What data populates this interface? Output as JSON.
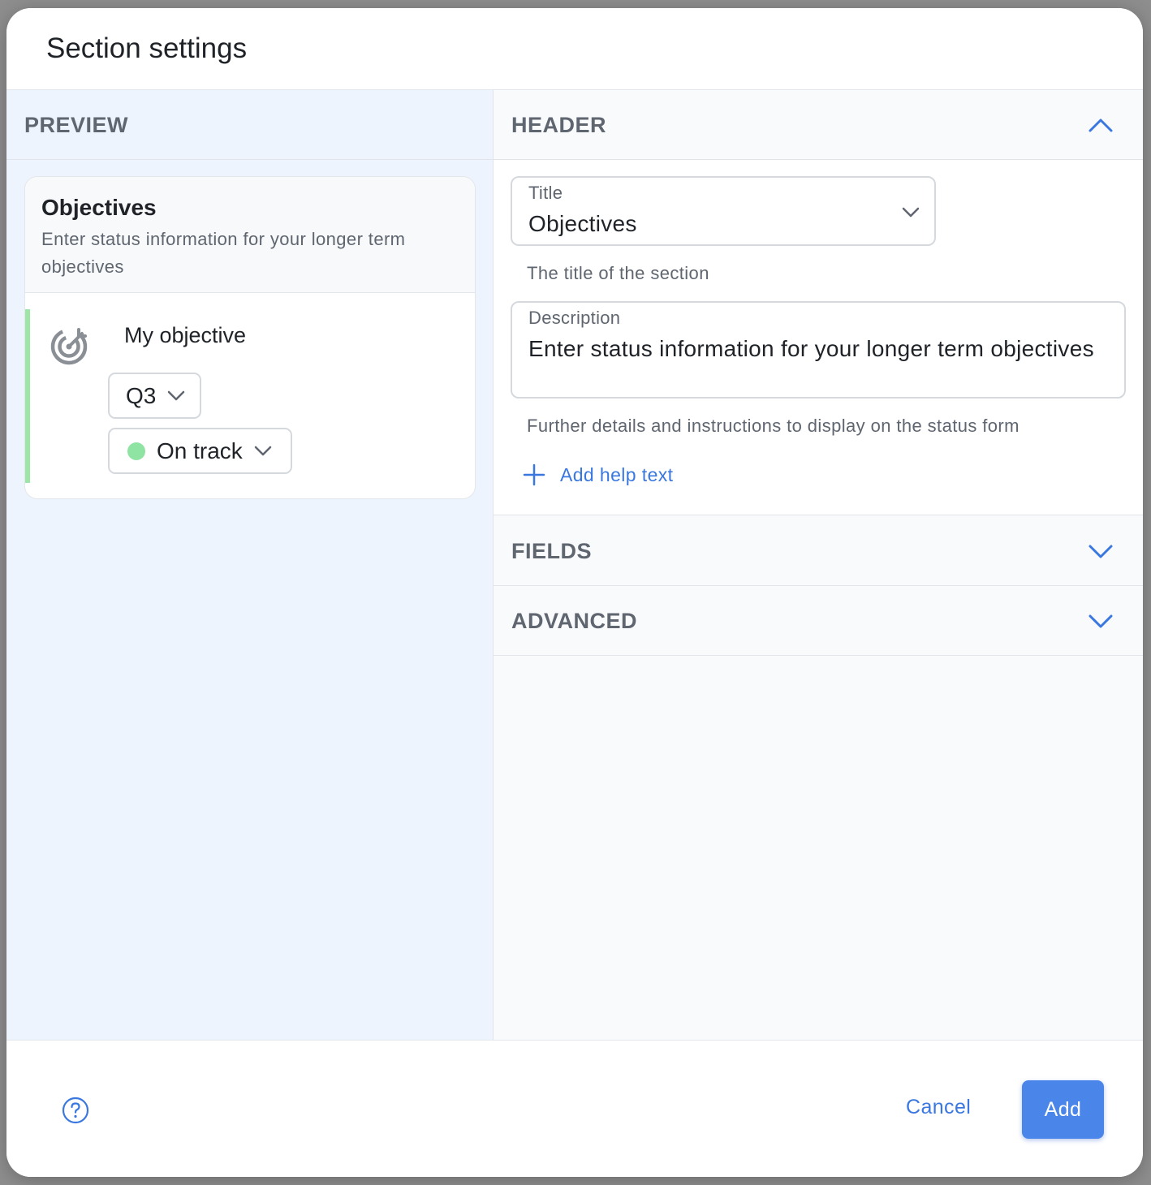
{
  "modal": {
    "title": "Section settings"
  },
  "preview": {
    "heading": "PREVIEW",
    "card": {
      "title": "Objectives",
      "description": "Enter status information for your longer term objectives",
      "objective_name": "My objective",
      "period": "Q3",
      "status": "On track",
      "status_color": "#8fe3a3",
      "accent_color": "#9ee6a8",
      "icon": "target-icon"
    }
  },
  "settings": {
    "header_section": {
      "label": "HEADER",
      "expanded": true,
      "title_field": {
        "label": "Title",
        "value": "Objectives",
        "hint": "The title of the section"
      },
      "description_field": {
        "label": "Description",
        "value": "Enter status information for your longer term objectives",
        "hint": "Further details and instructions to display on the status form"
      },
      "add_help_text": "Add help text"
    },
    "fields_section": {
      "label": "FIELDS",
      "expanded": false
    },
    "advanced_section": {
      "label": "ADVANCED",
      "expanded": false
    }
  },
  "footer": {
    "help_icon": "question-circle-icon",
    "cancel_label": "Cancel",
    "add_label": "Add"
  },
  "colors": {
    "accent": "#4a86ea",
    "link": "#3a78e0",
    "preview_bg": "#eef4fd"
  }
}
